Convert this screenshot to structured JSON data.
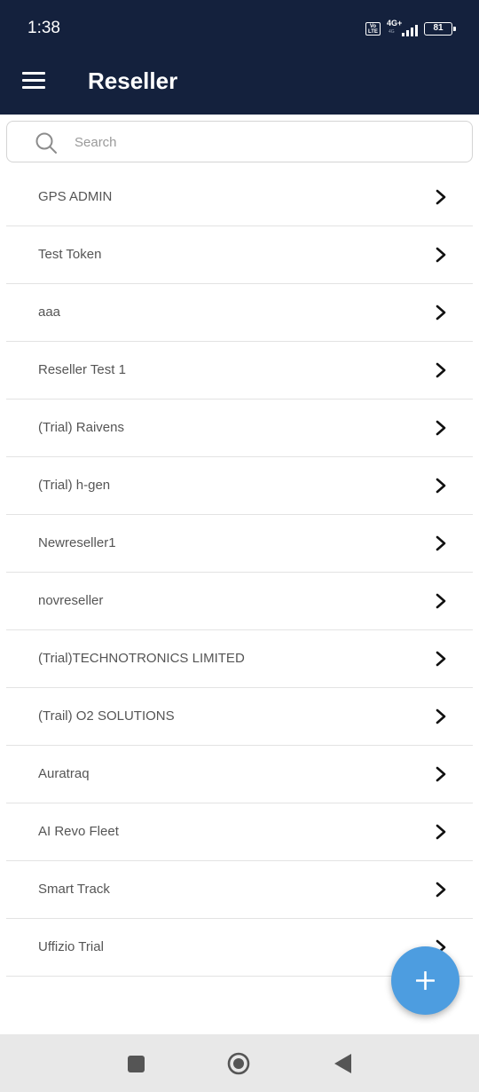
{
  "status_bar": {
    "time": "1:38",
    "volte_label": "Vo LTE",
    "network_label": "4G+",
    "network_sub": "4G",
    "battery": "81"
  },
  "app_bar": {
    "title": "Reseller",
    "menu_icon": "hamburger-menu-icon"
  },
  "search": {
    "placeholder": "Search",
    "value": "",
    "icon": "search-icon"
  },
  "resellers": [
    "GPS ADMIN",
    "Test Token",
    "aaa",
    "Reseller Test 1",
    "(Trial) Raivens",
    "(Trial) h-gen",
    "Newreseller1",
    "novreseller",
    "(Trial)TECHNOTRONICS LIMITED",
    "(Trail) O2 SOLUTIONS",
    "Auratraq",
    "AI Revo Fleet",
    "Smart Track",
    "Uffizio Trial"
  ],
  "fab": {
    "icon": "plus-icon"
  },
  "colors": {
    "header": "#14213d",
    "fab": "#4d9de0",
    "item_text": "#555555",
    "nav_bar": "#e8e8e8"
  }
}
